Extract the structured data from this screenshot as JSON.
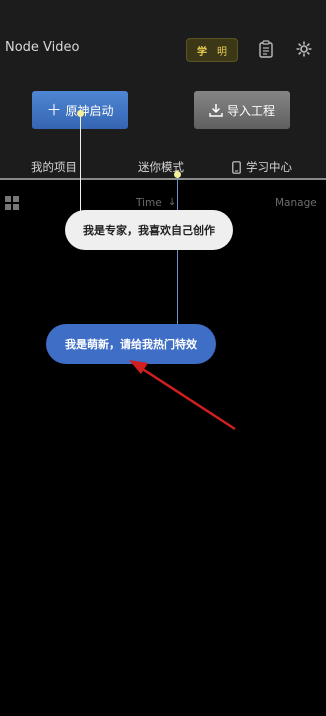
{
  "header": {
    "app_title": "Node Video",
    "badge": {
      "left": "学",
      "right": "明"
    }
  },
  "actions": {
    "start_label": "原神启动",
    "import_label": "导入工程"
  },
  "tabs": [
    {
      "label": "我的项目"
    },
    {
      "label": "迷你模式"
    },
    {
      "label": "学习中心"
    }
  ],
  "subbar": {
    "sort_label": "Time",
    "manage_label": "Manage"
  },
  "bubbles": {
    "expert": "我是专家，我喜欢自己创作",
    "novice": "我是萌新，请给我热门特效"
  },
  "colors": {
    "accent_blue": "#3e6ec5",
    "annotation_red": "#d11f1f",
    "badge_gold": "#e9cf56"
  },
  "icons": [
    "document-icon",
    "gear-icon",
    "plus-icon",
    "download-icon",
    "phone-icon",
    "grid-icon",
    "sort-down-icon"
  ]
}
